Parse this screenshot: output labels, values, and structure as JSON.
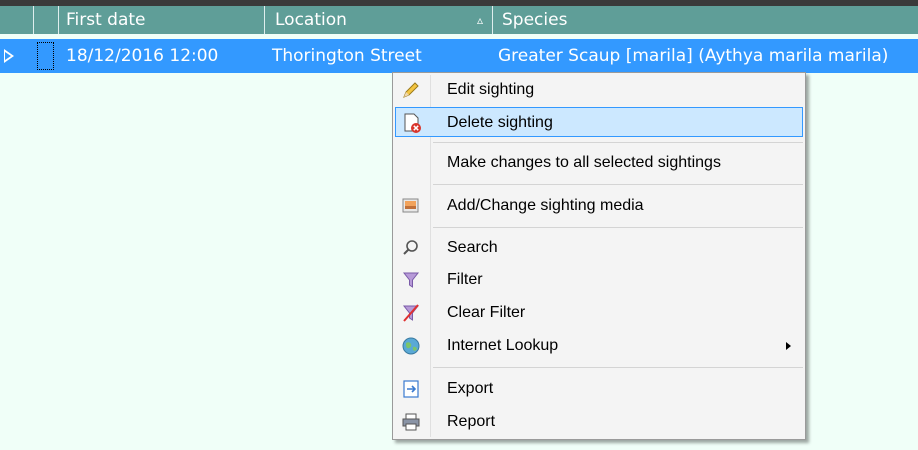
{
  "grid": {
    "columns": {
      "first_date": "First date",
      "location": "Location",
      "species": "Species",
      "location_sort_glyph": "▵"
    },
    "row": {
      "first_date": "18/12/2016 12:00",
      "location": "Thorington Street",
      "species": "Greater Scaup [marila] (Aythya marila marila)"
    }
  },
  "menu": {
    "items": [
      {
        "label": "Edit sighting",
        "icon": "pencil-icon"
      },
      {
        "label": "Delete sighting",
        "icon": "delete-document-icon"
      },
      {
        "label": "Make changes to all selected sightings",
        "icon": ""
      },
      {
        "label": "Add/Change sighting media",
        "icon": "media-icon"
      },
      {
        "label": "Search",
        "icon": "magnifier-icon"
      },
      {
        "label": "Filter",
        "icon": "filter-icon"
      },
      {
        "label": "Clear Filter",
        "icon": "clear-filter-icon"
      },
      {
        "label": "Internet Lookup",
        "icon": "globe-icon"
      },
      {
        "label": "Export",
        "icon": "export-icon"
      },
      {
        "label": "Report",
        "icon": "printer-icon"
      }
    ],
    "highlighted_index": 1
  },
  "colors": {
    "header_bg": "#5f9e98",
    "selected_row": "#3399ff",
    "background": "#f0fff8",
    "menu_highlight": "#cce8ff"
  }
}
